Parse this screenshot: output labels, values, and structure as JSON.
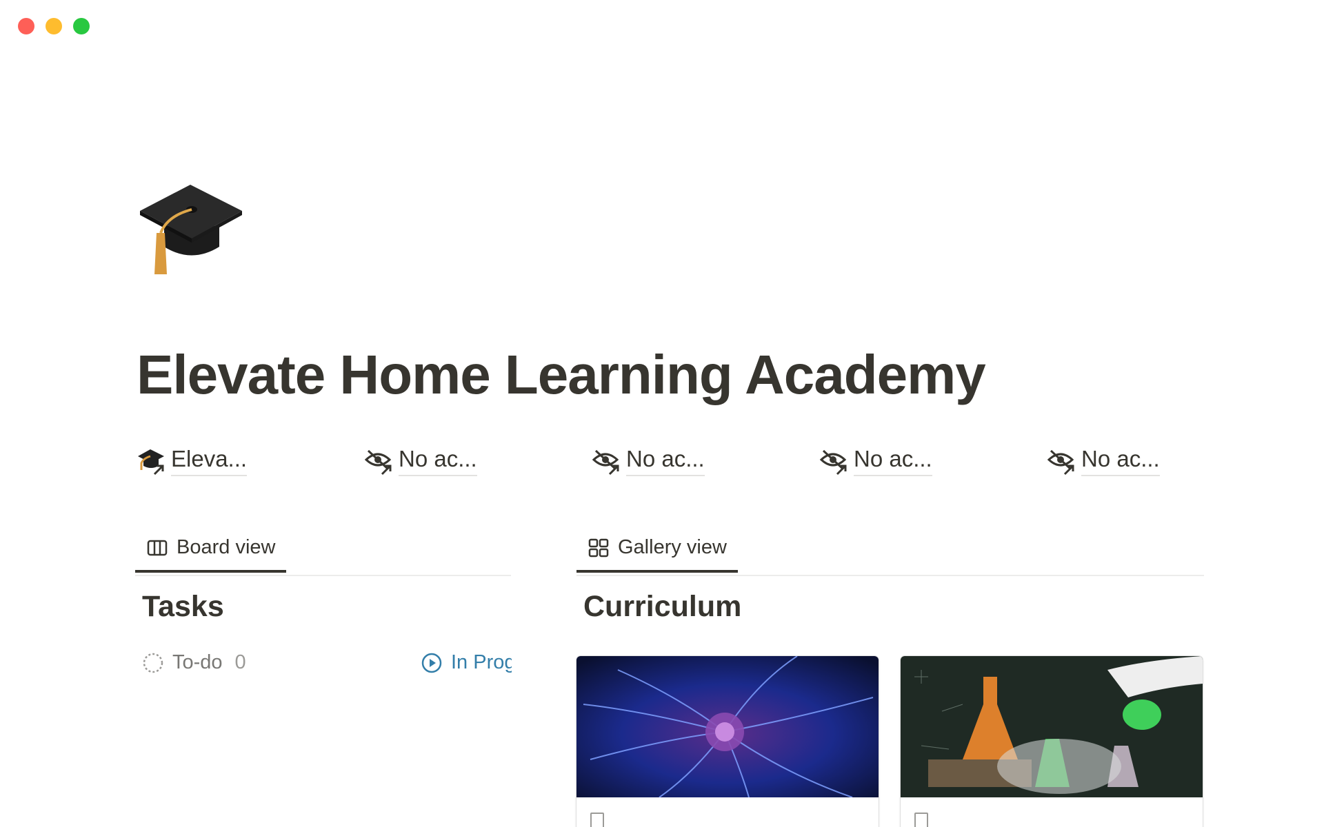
{
  "window": {
    "controls": [
      "close",
      "minimize",
      "maximize"
    ]
  },
  "page": {
    "icon": "graduation-cap-icon",
    "title": "Elevate Home Learning Academy"
  },
  "links": [
    {
      "label": "Eleva...",
      "icon": "graduation-cap-link-icon"
    },
    {
      "label": "No ac...",
      "icon": "eye-slash-link-icon"
    },
    {
      "label": "No ac...",
      "icon": "eye-slash-link-icon"
    },
    {
      "label": "No ac...",
      "icon": "eye-slash-link-icon"
    },
    {
      "label": "No ac...",
      "icon": "eye-slash-link-icon"
    }
  ],
  "left_section": {
    "tab": {
      "label": "Board view",
      "icon": "board-view-icon"
    },
    "heading": "Tasks",
    "groups": [
      {
        "label": "To-do",
        "count": "0",
        "icon": "dashed-circle-icon",
        "color": "#787774"
      },
      {
        "label": "In Progress",
        "icon": "play-circle-icon",
        "color": "#337ea9"
      }
    ]
  },
  "right_section": {
    "tab": {
      "label": "Gallery view",
      "icon": "gallery-view-icon"
    },
    "heading": "Curriculum",
    "cards": [
      {
        "cover": "plasma-ball-cover"
      },
      {
        "cover": "chemistry-flasks-cover"
      }
    ]
  },
  "colors": {
    "text": "#37352f",
    "muted": "#787774",
    "in_progress": "#337ea9",
    "tab_active": "#37352f"
  }
}
